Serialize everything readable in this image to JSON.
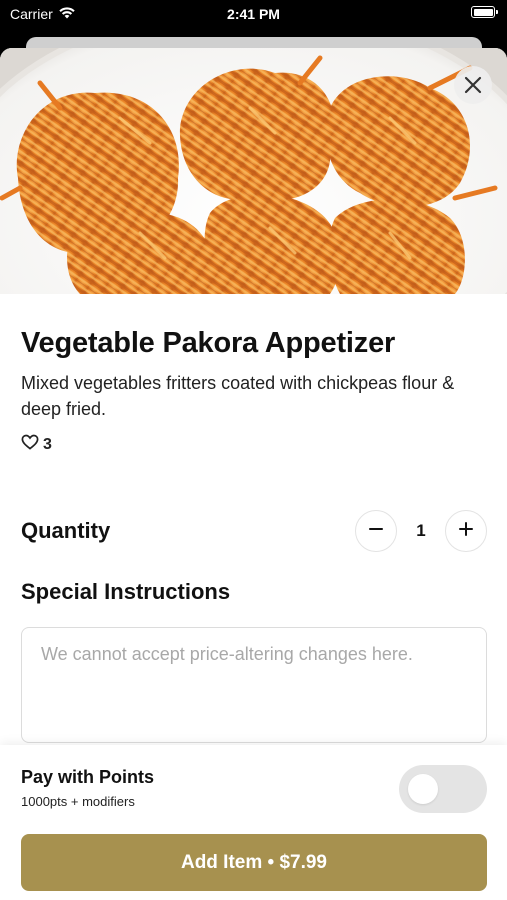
{
  "status_bar": {
    "carrier": "Carrier",
    "time": "2:41 PM",
    "icons": [
      "wifi-icon",
      "battery-icon"
    ]
  },
  "item": {
    "image_alt": "fried-pakora-photo",
    "title": "Vegetable Pakora Appetizer",
    "description": "Mixed vegetables fritters coated with chickpeas flour & deep fried.",
    "likes": "3",
    "like_icon": "heart-outline-icon"
  },
  "quantity": {
    "label": "Quantity",
    "value": "1",
    "decrement_icon": "minus-icon",
    "increment_icon": "plus-icon"
  },
  "instructions": {
    "label": "Special Instructions",
    "placeholder": "We cannot accept price-altering changes here.",
    "value": ""
  },
  "points": {
    "title": "Pay with Points",
    "subtitle": "1000pts + modifiers",
    "enabled": false
  },
  "add_button": {
    "label": "Add Item • $7.99"
  },
  "colors": {
    "accent": "#a7914f",
    "toggle_off": "#e4e4e4",
    "text": "#111111",
    "placeholder": "#a8a8a8"
  }
}
